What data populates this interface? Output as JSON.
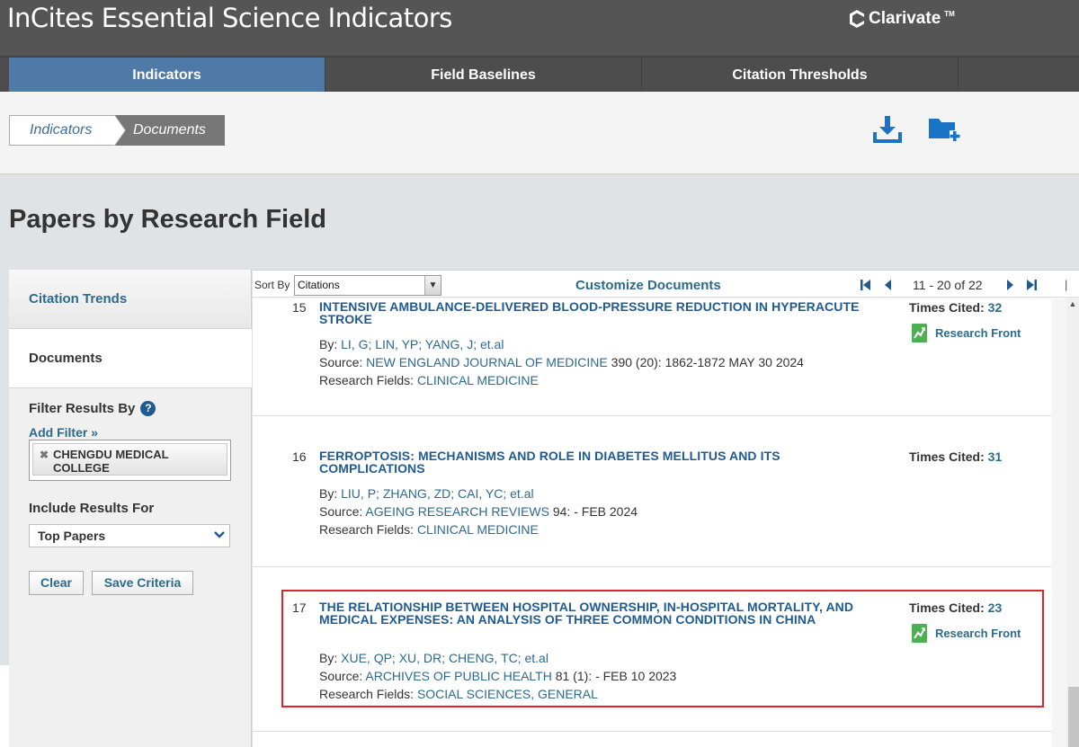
{
  "header": {
    "app_title": "InCites Essential Science Indicators",
    "brand": "Clarivate"
  },
  "nav": {
    "tabs": [
      {
        "label": "Indicators",
        "active": true
      },
      {
        "label": "Field Baselines",
        "active": false
      },
      {
        "label": "Citation Thresholds",
        "active": false
      }
    ]
  },
  "breadcrumb": {
    "items": [
      "Indicators",
      "Documents"
    ]
  },
  "toolbar_icons": [
    "download-icon",
    "add-to-folder-icon"
  ],
  "page_title": "Papers by Research Field",
  "left_panel": {
    "citation_trends": "Citation Trends",
    "documents": "Documents",
    "filter_label": "Filter Results By",
    "add_filter": "Add Filter »",
    "filters": [
      "CHENGDU MEDICAL COLLEGE"
    ],
    "include_label": "Include Results For",
    "include_value": "Top Papers",
    "clear_button": "Clear",
    "save_button": "Save Criteria"
  },
  "results_toolbar": {
    "sort_label": "Sort By",
    "sort_value": "Citations",
    "customize": "Customize Documents",
    "pager_range": "11 - 20 of 22"
  },
  "labels": {
    "by": "By:",
    "source": "Source:",
    "research_fields": "Research Fields:",
    "times_cited": "Times Cited:",
    "research_front": "Research Front"
  },
  "documents": [
    {
      "number": "15",
      "title": "INTENSIVE AMBULANCE-DELIVERED BLOOD-PRESSURE REDUCTION IN HYPERACUTE STROKE",
      "authors": [
        "LI, G;",
        "LIN, YP;",
        "YANG, J;",
        "et.al"
      ],
      "source_journal": "NEW ENGLAND JOURNAL OF MEDICINE",
      "source_details": "390 (20): 1862-1872 MAY 30 2024",
      "research_field": "CLINICAL MEDICINE",
      "times_cited": "32",
      "research_front": true
    },
    {
      "number": "16",
      "title": "FERROPTOSIS: MECHANISMS AND ROLE IN DIABETES MELLITUS AND ITS COMPLICATIONS",
      "authors": [
        "LIU, P;",
        "ZHANG, ZD;",
        "CAI, YC;",
        "et.al"
      ],
      "source_journal": "AGEING RESEARCH REVIEWS",
      "source_details": "94: - FEB 2024",
      "research_field": "CLINICAL MEDICINE",
      "times_cited": "31",
      "research_front": false
    },
    {
      "number": "17",
      "title": "THE RELATIONSHIP BETWEEN HOSPITAL OWNERSHIP, IN-HOSPITAL MORTALITY, AND MEDICAL EXPENSES: AN ANALYSIS OF THREE COMMON CONDITIONS IN CHINA",
      "authors": [
        "XUE, QP;",
        "XU, DR;",
        "CHENG, TC;",
        "et.al"
      ],
      "source_journal": "ARCHIVES OF PUBLIC HEALTH",
      "source_details": "81 (1): - FEB 10 2023",
      "research_field": "SOCIAL SCIENCES, GENERAL",
      "times_cited": "23",
      "research_front": true
    }
  ],
  "colors": {
    "header_bg": "#555555",
    "active_tab": "#4f7aa8",
    "link": "#1f5b92",
    "highlight": "#d9262c"
  }
}
